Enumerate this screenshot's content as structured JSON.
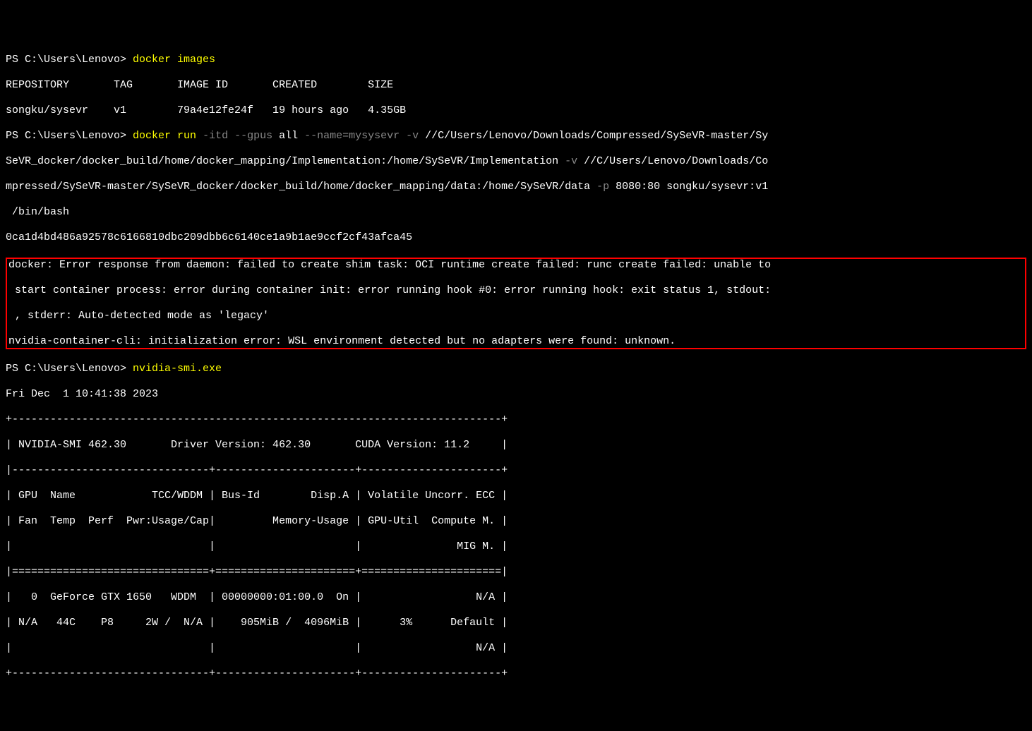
{
  "l1_prompt": "PS C:\\Users\\Lenovo> ",
  "l1_cmd1": "docker ",
  "l1_cmd2": "images",
  "l2_header": "REPOSITORY       TAG       IMAGE ID       CREATED        SIZE",
  "l3_row": "songku/sysevr    v1        79a4e12fe24f   19 hours ago   4.35GB",
  "l4_prompt": "PS C:\\Users\\Lenovo> ",
  "l4_cmd1": "docker ",
  "l4_cmd2": "run ",
  "l4_flags1": "-itd --gpus ",
  "l4_all": "all ",
  "l4_flags2": "--name=mysysevr -v ",
  "l4_path1": "//C/Users/Lenovo/Downloads/Compressed/SySeVR-master/Sy",
  "l5_path1": "SeVR_docker/docker_build/home/docker_mapping/Implementation:/home/SySeVR/Implementation ",
  "l5_flags3": "-v ",
  "l5_path2": "//C/Users/Lenovo/Downloads/Co",
  "l6_path1": "mpressed/SySeVR-master/SySeVR_docker/docker_build/home/docker_mapping/data:/home/SySeVR/data ",
  "l6_flags4": "-p ",
  "l6_rest": "8080:80 songku/sysevr:v1",
  "l7_rest": " /bin/bash",
  "l8_hash": "0ca1d4bd486a92578c6166810dbc209dbb6c6140ce1a9b1ae9ccf2cf43afca45",
  "err1": "docker: Error response from daemon: failed to create shim task: OCI runtime create failed: runc create failed: unable to",
  "err2": " start container process: error during container init: error running hook #0: error running hook: exit status 1, stdout:",
  "err3": " , stderr: Auto-detected mode as 'legacy'",
  "err4": "nvidia-container-cli: initialization error: WSL environment detected but no adapters were found: unknown.",
  "l13_prompt": "PS C:\\Users\\Lenovo> ",
  "l13_cmd": "nvidia-smi.exe",
  "l14_date": "Fri Dec  1 10:41:38 2023",
  "smi1": "+-----------------------------------------------------------------------------+",
  "smi2": "| NVIDIA-SMI 462.30       Driver Version: 462.30       CUDA Version: 11.2     |",
  "smi3": "|-------------------------------+----------------------+----------------------+",
  "smi4": "| GPU  Name            TCC/WDDM | Bus-Id        Disp.A | Volatile Uncorr. ECC |",
  "smi5": "| Fan  Temp  Perf  Pwr:Usage/Cap|         Memory-Usage | GPU-Util  Compute M. |",
  "smi6": "|                               |                      |               MIG M. |",
  "smi7": "|===============================+======================+======================|",
  "smi8": "|   0  GeForce GTX 1650   WDDM  | 00000000:01:00.0  On |                  N/A |",
  "smi9": "| N/A   44C    P8     2W /  N/A |    905MiB /  4096MiB |      3%      Default |",
  "smi10": "|                               |                      |                  N/A |",
  "smi11": "+-------------------------------+----------------------+----------------------+"
}
